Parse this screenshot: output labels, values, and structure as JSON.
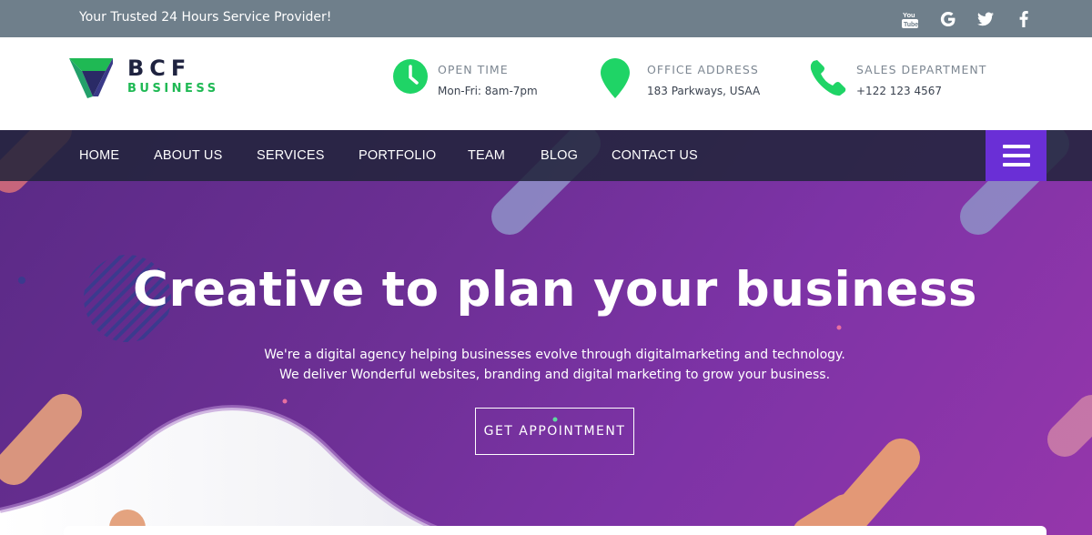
{
  "topbar": {
    "tagline": "Your Trusted 24 Hours Service Provider!",
    "social": [
      "youtube-icon",
      "google-icon",
      "twitter-icon",
      "facebook-icon"
    ]
  },
  "brand": {
    "name": "BCF",
    "sub": "BUSINESS"
  },
  "contact": [
    {
      "label": "OPEN TIME",
      "value": "Mon-Fri: 8am-7pm",
      "icon": "clock-icon"
    },
    {
      "label": "OFFICE ADDRESS",
      "value": "183 Parkways, USAA",
      "icon": "map-pin-icon"
    },
    {
      "label": "SALES DEPARTMENT",
      "value": "+122 123 4567",
      "icon": "phone-icon"
    }
  ],
  "nav": {
    "items": [
      "HOME",
      "ABOUT US",
      "SERVICES",
      "PORTFOLIO",
      "TEAM",
      "BLOG",
      "CONTACT US"
    ],
    "menu_icon": "hamburger-icon"
  },
  "hero": {
    "headline": "Creative to plan your business",
    "line1": "We're a digital agency helping businesses evolve through digitalmarketing and technology.",
    "line2": "We deliver Wonderful websites, branding and digital marketing to grow your business.",
    "cta": "GET APPOINTMENT"
  },
  "colors": {
    "accent_green": "#1fd466",
    "menu_purple": "#6a2fd6",
    "topbar": "#6f7f8b"
  }
}
